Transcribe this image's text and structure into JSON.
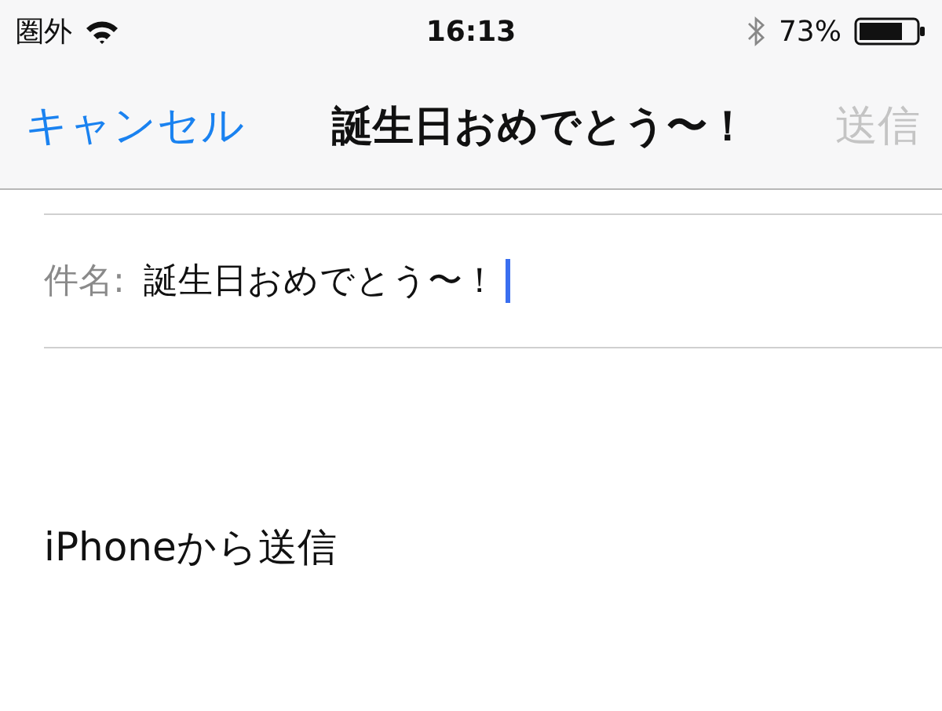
{
  "status_bar": {
    "carrier": "圏外",
    "time": "16:13",
    "battery": "73%"
  },
  "nav_bar": {
    "cancel": "キャンセル",
    "title": "誕生日おめでとう〜！",
    "send": {
      "label": "送信",
      "disabled": true
    }
  },
  "subject": {
    "label": "件名:",
    "value": "誕生日おめでとう〜！",
    "focused": true
  },
  "body": "iPhoneから送信"
}
